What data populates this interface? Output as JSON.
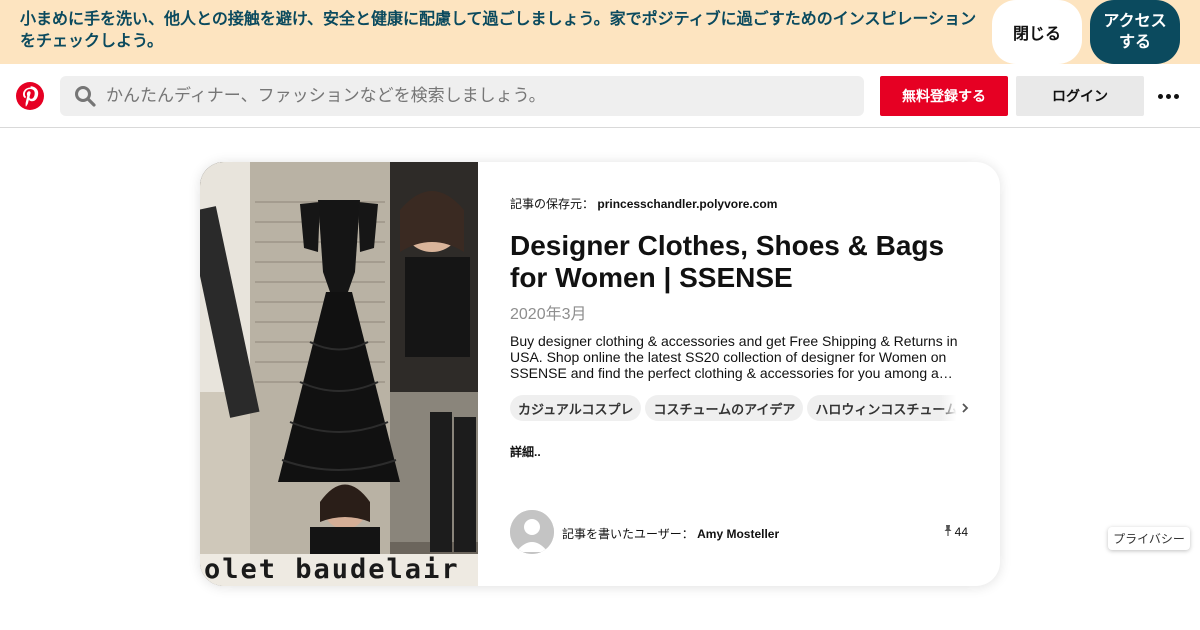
{
  "banner": {
    "message": "小まめに手を洗い、他人との接触を避け、安全と健康に配慮して過ごしましょう。家でポジティブに過ごすためのインスピレーションをチェックしよう。",
    "close_label": "閉じる",
    "access_label": "アクセスする"
  },
  "header": {
    "logo": "pinterest-logo",
    "search_placeholder": "かんたんディナー、ファッションなどを検索しましょう。",
    "signup_label": "無料登録する",
    "login_label": "ログイン",
    "more_icon": "ellipsis-icon"
  },
  "pin": {
    "saved_from_label": "記事の保存元：",
    "saved_from_source": "princesschandler.polyvore.com",
    "title": "Designer Clothes, Shoes & Bags for Women | SSENSE",
    "date": "2020年3月",
    "description": "Buy designer clothing & accessories and get Free Shipping & Returns in USA. Shop online the latest SS20 collection of designer for Women on SSENSE and find the perfect clothing & accessories for you among a…",
    "tags": [
      "カジュアルコスプレ",
      "コスチュームのアイデア",
      "ハロウィンコスチューム"
    ],
    "more_label": "詳細..",
    "author_label": "記事を書いたユーザー：",
    "author_name": "Amy Mosteller",
    "pin_count": "44",
    "image_caption": "olet baudelair"
  },
  "footer": {
    "privacy_label": "プライバシー"
  },
  "colors": {
    "banner_bg": "#fde4c0",
    "banner_text": "#0b4a5e",
    "brand_red": "#e60023"
  }
}
